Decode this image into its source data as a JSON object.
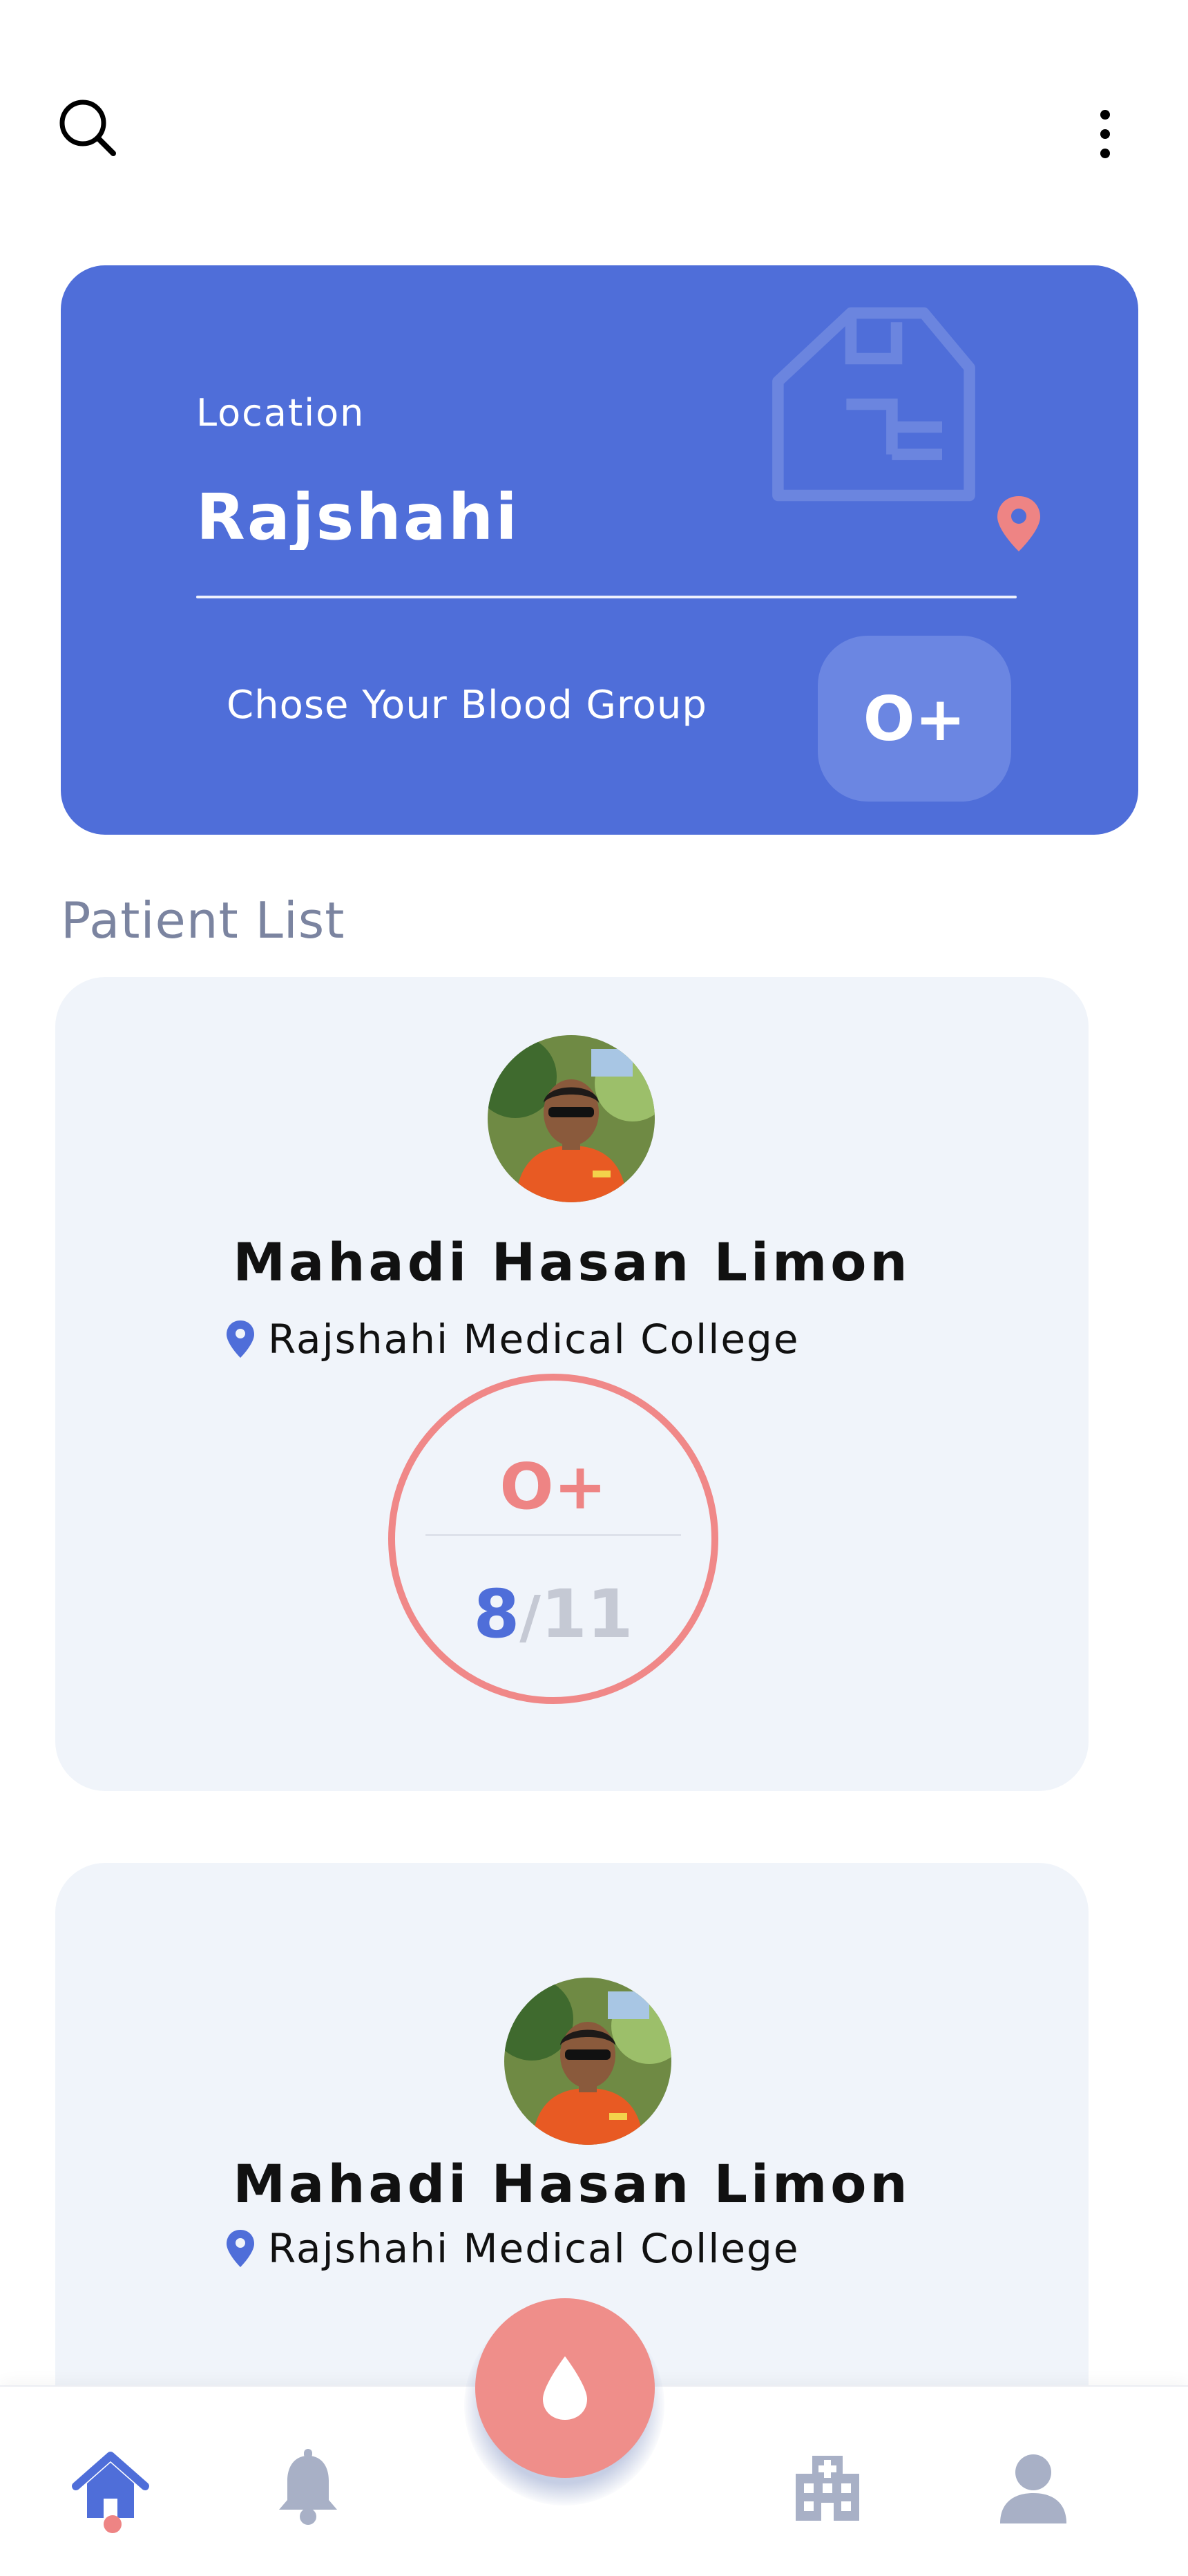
{
  "header": {
    "search_icon": "search-icon",
    "menu_icon": "more-vertical-icon"
  },
  "location_card": {
    "label": "Location",
    "value": "Rajshahi",
    "blood_prompt": "Chose Your Blood Group",
    "selected_blood_group": "O+",
    "accent_color": "#4f6ed9",
    "pin_color": "#ee8484"
  },
  "patient_list": {
    "title": "Patient List",
    "items": [
      {
        "name": "Mahadi Hasan Limon",
        "location": "Rajshahi Medical College",
        "blood_group": "O+",
        "bags_collected": "8",
        "separator": "/",
        "bags_needed": "11"
      },
      {
        "name": "Mahadi Hasan Limon",
        "location": "Rajshahi Medical College"
      }
    ]
  },
  "bottom_nav": {
    "items": [
      "home-icon",
      "bell-icon",
      "hospital-icon",
      "profile-icon"
    ],
    "active": "home-icon",
    "fab_icon": "blood-drop-icon",
    "fab_color": "#ef8e8a"
  }
}
